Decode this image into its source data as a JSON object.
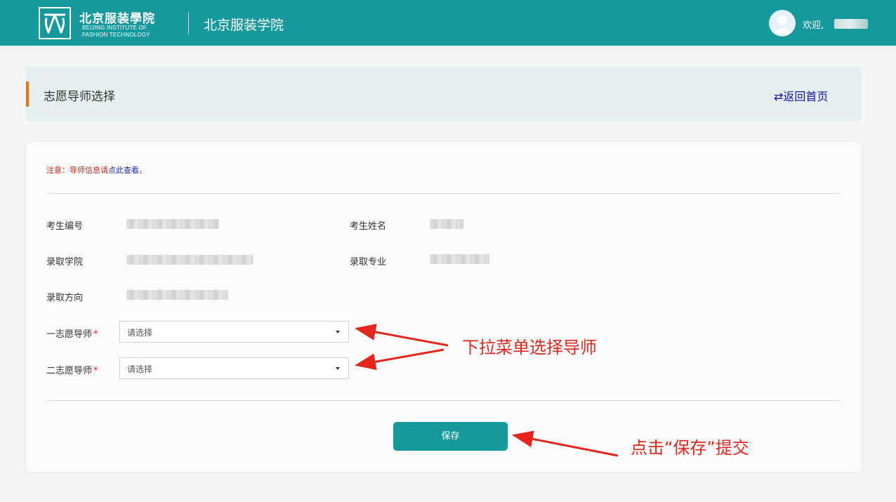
{
  "header": {
    "logo_cn": "北京服装學院",
    "logo_en_line1": "BEIJING INSTITUTE OF",
    "logo_en_line2": "FASHION TECHNOLOGY",
    "site_title": "北京服装学院",
    "welcome": "欢迎,"
  },
  "page": {
    "title": "志愿导师选择",
    "back_icon": "⇄",
    "back_label": "返回首页"
  },
  "notice": {
    "prefix": "注意：导师信息请",
    "link": "点此查看",
    "suffix": "。"
  },
  "fields": {
    "candidate_id_label": "考生编号",
    "candidate_name_label": "考生姓名",
    "college_label": "录取学院",
    "major_label": "录取专业",
    "direction_label": "录取方向",
    "first_choice_label": "一志愿导师",
    "second_choice_label": "二志愿导师",
    "required_mark": "*"
  },
  "selects": {
    "first_value": "请选择",
    "second_value": "请选择"
  },
  "actions": {
    "save_label": "保存"
  },
  "annotations": {
    "dropdown_note": "下拉菜单选择导师",
    "save_note": "点击“保存”提交"
  },
  "colors": {
    "header_bg": "#16999c",
    "accent_bar": "#e8731f",
    "notice_red": "#c9261b",
    "link_blue": "#1c30a6",
    "annotation_red": "#e5261c",
    "button_teal": "#15999c"
  },
  "icons": [
    "bift-logo-icon",
    "avatar-icon",
    "exchange-icon",
    "caret-down-icon",
    "arrow-annotation-icon"
  ]
}
